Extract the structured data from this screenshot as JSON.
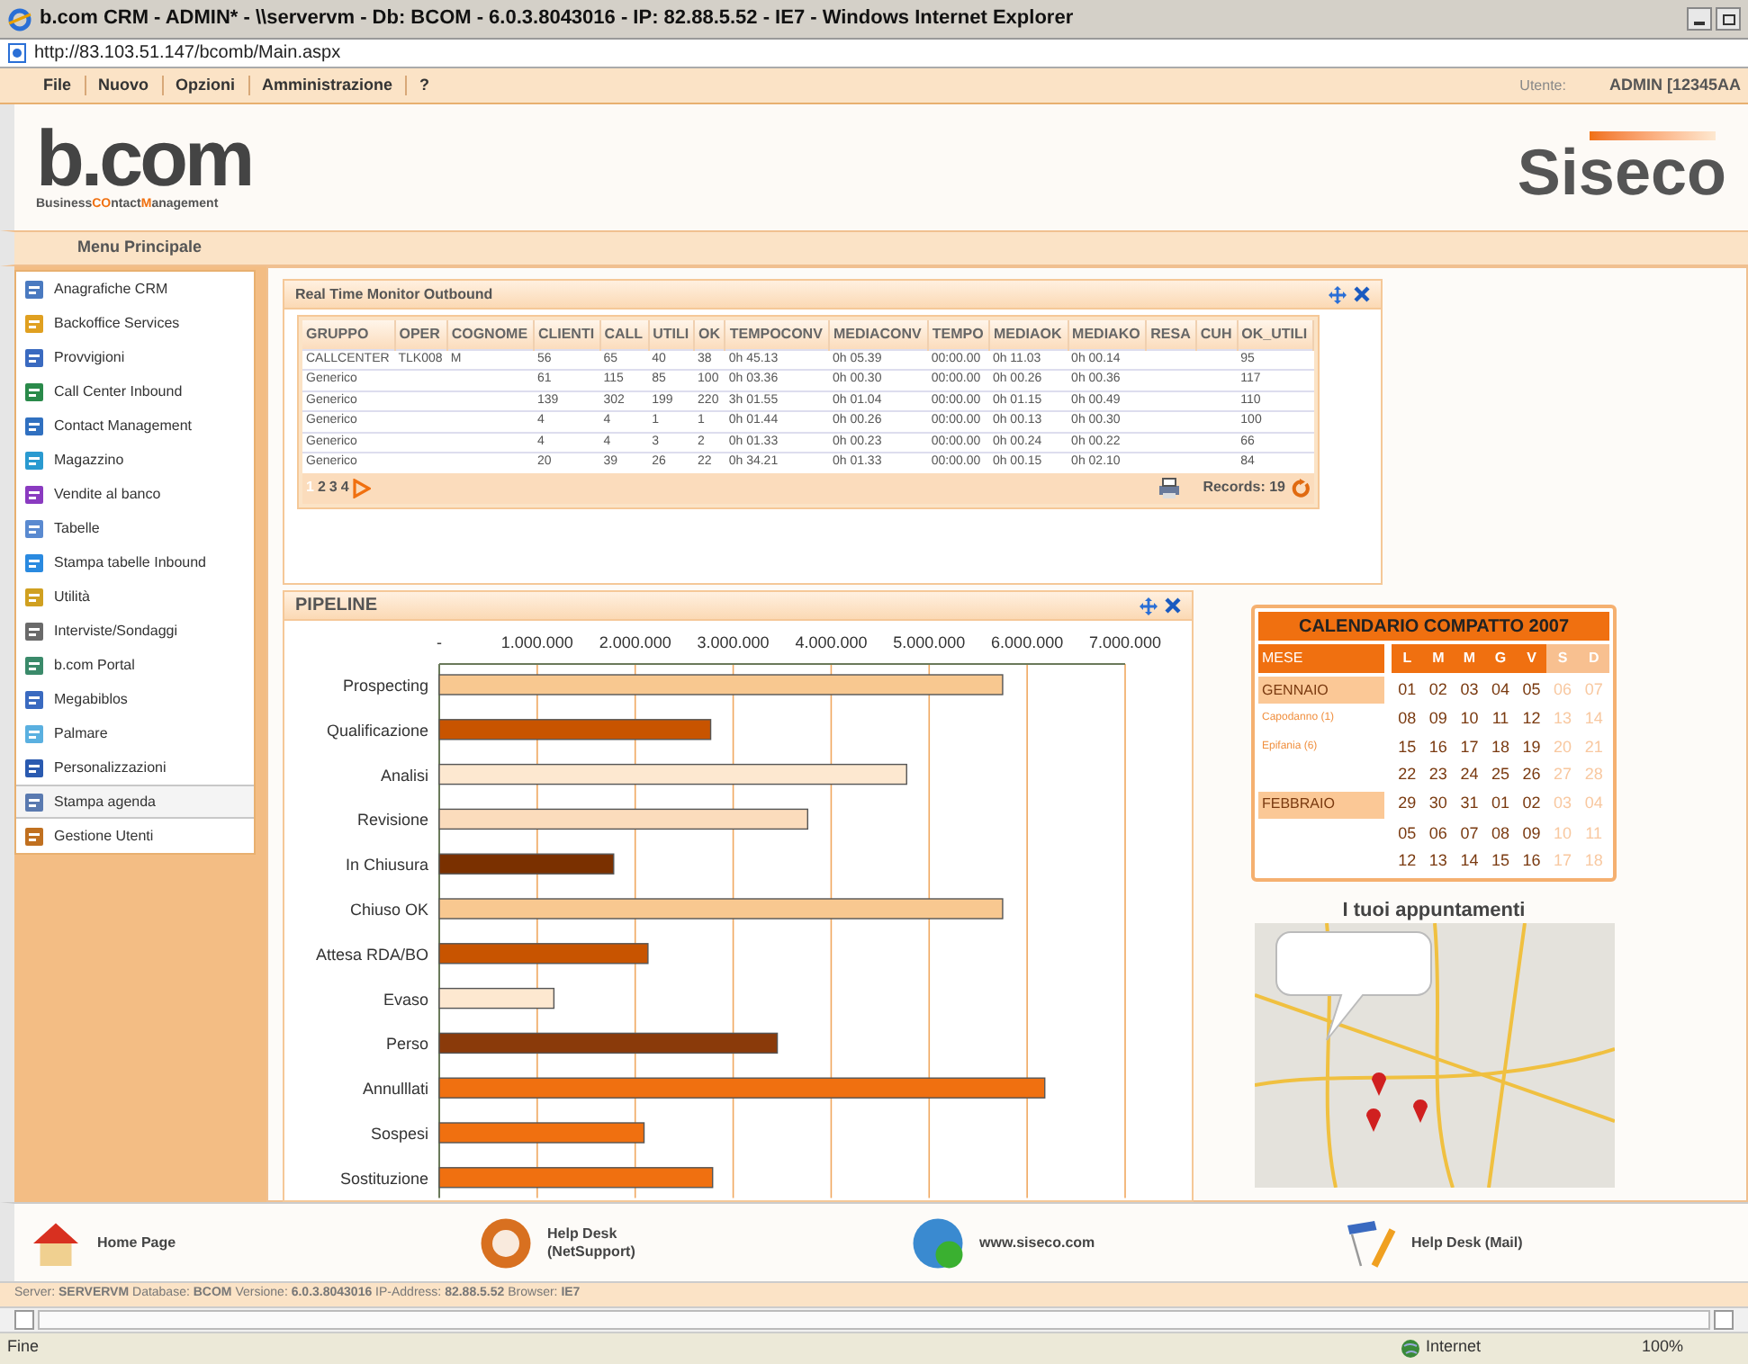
{
  "window": {
    "title": "b.com CRM - ADMIN* - \\\\servervm - Db: BCOM - 6.0.3.8043016 - IP: 82.88.5.52 - IE7 - Windows Internet Explorer",
    "address": "http://83.103.51.147/bcomb/Main.aspx"
  },
  "menu_bar": {
    "items": [
      "File",
      "Nuovo",
      "Opzioni",
      "Amministrazione",
      "?"
    ],
    "user_label": "Utente:",
    "user": "ADMIN [12345AA"
  },
  "header": {
    "logo": "b.com",
    "tagline": [
      {
        "text": "Business",
        "accent": false
      },
      {
        "text": "CO",
        "accent": true
      },
      {
        "text": "ntact",
        "accent": false
      },
      {
        "text": "M",
        "accent": true
      },
      {
        "text": "anagement",
        "accent": false
      }
    ],
    "brand": "Siseco"
  },
  "sidebar": {
    "title": "Menu Principale",
    "items": [
      {
        "label": "Anagrafiche CRM",
        "selected": false
      },
      {
        "label": "Backoffice Services",
        "selected": false
      },
      {
        "label": "Provvigioni",
        "selected": false
      },
      {
        "label": "Call Center Inbound",
        "selected": false
      },
      {
        "label": "Contact Management",
        "selected": false
      },
      {
        "label": "Magazzino",
        "selected": false
      },
      {
        "label": "Vendite al banco",
        "selected": false
      },
      {
        "label": "Tabelle",
        "selected": false
      },
      {
        "label": "Stampa tabelle Inbound",
        "selected": false
      },
      {
        "label": "Utilità",
        "selected": false
      },
      {
        "label": "Interviste/Sondaggi",
        "selected": false
      },
      {
        "label": "b.com Portal",
        "selected": false
      },
      {
        "label": "Megabiblos",
        "selected": false
      },
      {
        "label": "Palmare",
        "selected": false
      },
      {
        "label": "Personalizzazioni",
        "selected": false
      },
      {
        "label": "Stampa agenda",
        "selected": true
      },
      {
        "label": "Gestione Utenti",
        "selected": false
      }
    ]
  },
  "monitor": {
    "title": "Real Time Monitor Outbound",
    "columns": [
      "GRUPPO",
      "OPER",
      "COGNOME",
      "CLIENTI",
      "CALL",
      "UTILI",
      "OK",
      "TEMPOCONV",
      "MEDIACONV",
      "TEMPO",
      "MEDIAOK",
      "MEDIAKO",
      "RESA",
      "CUH",
      "OK_UTILI"
    ],
    "rows": [
      [
        "CALLCENTER",
        "TLK008",
        "M",
        "56",
        "65",
        "40",
        "38",
        "0h 45.13",
        "0h 05.39",
        "00:00.00",
        "0h 11.03",
        "0h 00.14",
        "",
        "",
        "95"
      ],
      [
        "Generico",
        "",
        "",
        "61",
        "115",
        "85",
        "100",
        "0h 03.36",
        "0h 00.30",
        "00:00.00",
        "0h 00.26",
        "0h 00.36",
        "",
        "",
        "117"
      ],
      [
        "Generico",
        "",
        "",
        "139",
        "302",
        "199",
        "220",
        "3h 01.55",
        "0h 01.04",
        "00:00.00",
        "0h 01.15",
        "0h 00.49",
        "",
        "",
        "110"
      ],
      [
        "Generico",
        "",
        "",
        "4",
        "4",
        "1",
        "1",
        "0h 01.44",
        "0h 00.26",
        "00:00.00",
        "0h 00.13",
        "0h 00.30",
        "",
        "",
        "100"
      ],
      [
        "Generico",
        "",
        "",
        "4",
        "4",
        "3",
        "2",
        "0h 01.33",
        "0h 00.23",
        "00:00.00",
        "0h 00.24",
        "0h 00.22",
        "",
        "",
        "66"
      ],
      [
        "Generico",
        "",
        "",
        "20",
        "39",
        "26",
        "22",
        "0h 34.21",
        "0h 01.33",
        "00:00.00",
        "0h 00.15",
        "0h 02.10",
        "",
        "",
        "84"
      ]
    ],
    "pages": [
      {
        "label": "1",
        "selected": true
      },
      {
        "label": "2",
        "selected": false
      },
      {
        "label": "3",
        "selected": false
      },
      {
        "label": "4",
        "selected": false
      }
    ],
    "records": "Records: 19"
  },
  "pipeline": {
    "title": "PIPELINE",
    "chart_data": {
      "type": "bar",
      "orientation": "horizontal",
      "categories": [
        "Prospecting",
        "Qualificazione",
        "Analisi",
        "Revisione",
        "In Chiusura",
        "Chiuso OK",
        "Attesa RDA/BO",
        "Evaso",
        "Perso",
        "Annulllati",
        "Sospesi",
        "Sostituzione"
      ],
      "series": [
        {
          "values": [
            5750000,
            2770000,
            4770000,
            3760000,
            1780000,
            5750000,
            2130000,
            1170000,
            3450000,
            6180000,
            2090000,
            2790000
          ],
          "colors": [
            "#f8c890",
            "#c85400",
            "#fde8d0",
            "#fbdcbc",
            "#7a3000",
            "#f8c890",
            "#c85400",
            "#fde8d0",
            "#8a3a0a",
            "#f07010",
            "#f07010",
            "#f07010"
          ]
        }
      ],
      "xlim": [
        0,
        7000000
      ],
      "grid": true,
      "xticks": [
        {
          "value": 0,
          "label": "-"
        },
        {
          "value": 1000000,
          "label": "1.000.000"
        },
        {
          "value": 2000000,
          "label": "2.000.000"
        },
        {
          "value": 3000000,
          "label": "3.000.000"
        },
        {
          "value": 4000000,
          "label": "4.000.000"
        },
        {
          "value": 5000000,
          "label": "5.000.000"
        },
        {
          "value": 6000000,
          "label": "6.000.000"
        },
        {
          "value": 7000000,
          "label": "7.000.000"
        }
      ]
    }
  },
  "calendar": {
    "title": "CALENDARIO COMPATTO 2007",
    "month_header": "MESE",
    "weekdays": [
      {
        "label": "L",
        "weekend": false
      },
      {
        "label": "M",
        "weekend": false
      },
      {
        "label": "M",
        "weekend": false
      },
      {
        "label": "G",
        "weekend": false
      },
      {
        "label": "V",
        "weekend": false
      },
      {
        "label": "S",
        "weekend": true
      },
      {
        "label": "D",
        "weekend": true
      }
    ],
    "rows": [
      {
        "label": "GENNAIO",
        "kind": "month",
        "days": [
          "01",
          "02",
          "03",
          "04",
          "05",
          "06",
          "07"
        ]
      },
      {
        "label": "Capodanno (1)",
        "kind": "holiday",
        "days": [
          "08",
          "09",
          "10",
          "11",
          "12",
          "13",
          "14"
        ]
      },
      {
        "label": "Epifania (6)",
        "kind": "holiday",
        "days": [
          "15",
          "16",
          "17",
          "18",
          "19",
          "20",
          "21"
        ]
      },
      {
        "kind": "empty",
        "days": [
          "22",
          "23",
          "24",
          "25",
          "26",
          "27",
          "28"
        ]
      },
      {
        "label": "FEBBRAIO",
        "kind": "month",
        "days": [
          "29",
          "30",
          "31",
          "01",
          "02",
          "03",
          "04"
        ]
      },
      {
        "kind": "empty",
        "days": [
          "05",
          "06",
          "07",
          "08",
          "09",
          "10",
          "11"
        ]
      },
      {
        "kind": "empty",
        "days": [
          "12",
          "13",
          "14",
          "15",
          "16",
          "17",
          "18"
        ]
      }
    ]
  },
  "appointments": {
    "title": "I tuoi appuntamenti"
  },
  "footer_links": [
    {
      "label": "Home Page"
    },
    {
      "label": "Help Desk\n(NetSupport)"
    },
    {
      "label": "www.siseco.com"
    },
    {
      "label": "Help Desk (Mail)"
    }
  ],
  "server_info": "Server: **SERVERVM** Database: **BCOM** Versione: **6.0.3.8043016** IP-Address: **82.88.5.52** Browser: **IE7**",
  "status_bar": {
    "text": "Fine",
    "zone": "Internet",
    "zoom": "100%"
  }
}
